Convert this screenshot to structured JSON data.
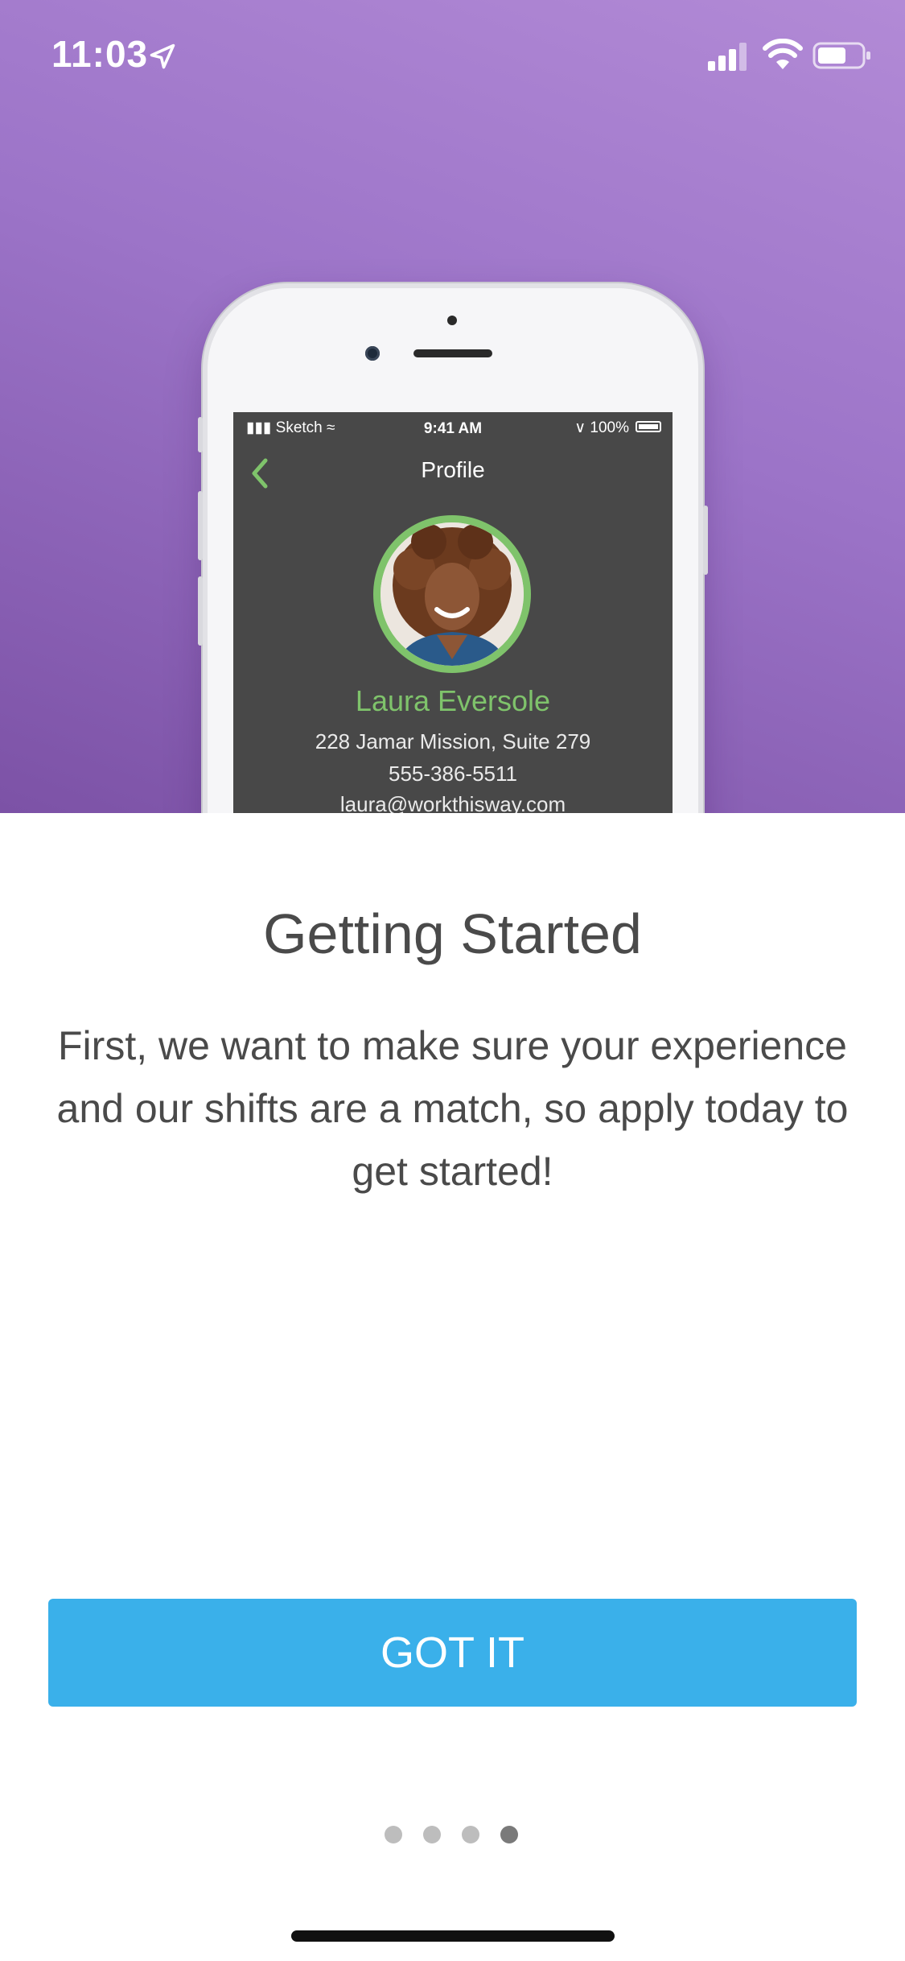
{
  "status_bar": {
    "time": "11:03"
  },
  "mockup": {
    "status": {
      "carrier": "Sketch",
      "time": "9:41 AM",
      "battery": "100%"
    },
    "nav_title": "Profile",
    "name": "Laura Eversole",
    "address": "228 Jamar Mission, Suite 279",
    "phone": "555-386-5511",
    "email": "laura@workthisway.com"
  },
  "onboarding": {
    "title": "Getting Started",
    "body": "First, we want to make sure your experience and our shifts are a match, so apply today to get started!",
    "button_label": "GOT IT",
    "pages": 4,
    "current_page": 4
  },
  "colors": {
    "hero_gradient_top": "#b28ad6",
    "hero_gradient_bottom": "#7c52a6",
    "accent_green": "#7fc36b",
    "button_blue": "#3ab0ea",
    "text_gray": "#4a4a4a"
  }
}
